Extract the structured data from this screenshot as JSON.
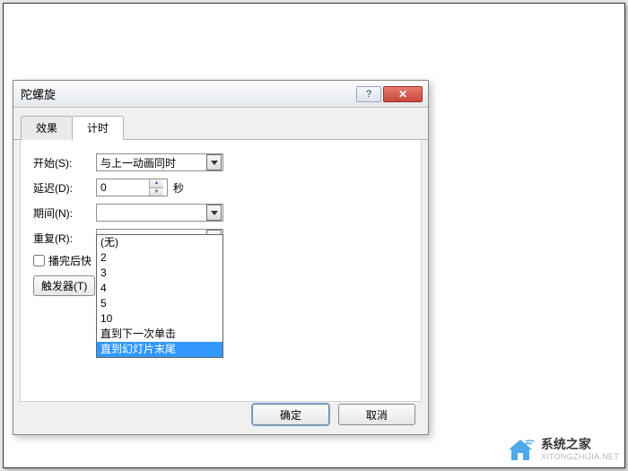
{
  "dialog": {
    "title": "陀螺旋",
    "help": "?",
    "close": "✕",
    "tabs": {
      "effect": "效果",
      "timing": "计时"
    },
    "form": {
      "start_label": "开始(S):",
      "start_value": "与上一动画同时",
      "delay_label": "延迟(D):",
      "delay_value": "0",
      "delay_unit": "秒",
      "duration_label": "期间(N):",
      "duration_value": "",
      "repeat_label": "重复(R):",
      "repeat_value": "",
      "rewind_label": "播完后快",
      "trigger_label": "触发器(T)"
    },
    "repeat_options": {
      "none": "(无)",
      "o2": "2",
      "o3": "3",
      "o4": "4",
      "o5": "5",
      "o10": "10",
      "until_click": "直到下一次单击",
      "until_end": "直到幻灯片末尾"
    },
    "buttons": {
      "ok": "确定",
      "cancel": "取消"
    }
  },
  "watermark": {
    "main": "系统之家",
    "sub": "XITONGZHIJIA.NET"
  }
}
